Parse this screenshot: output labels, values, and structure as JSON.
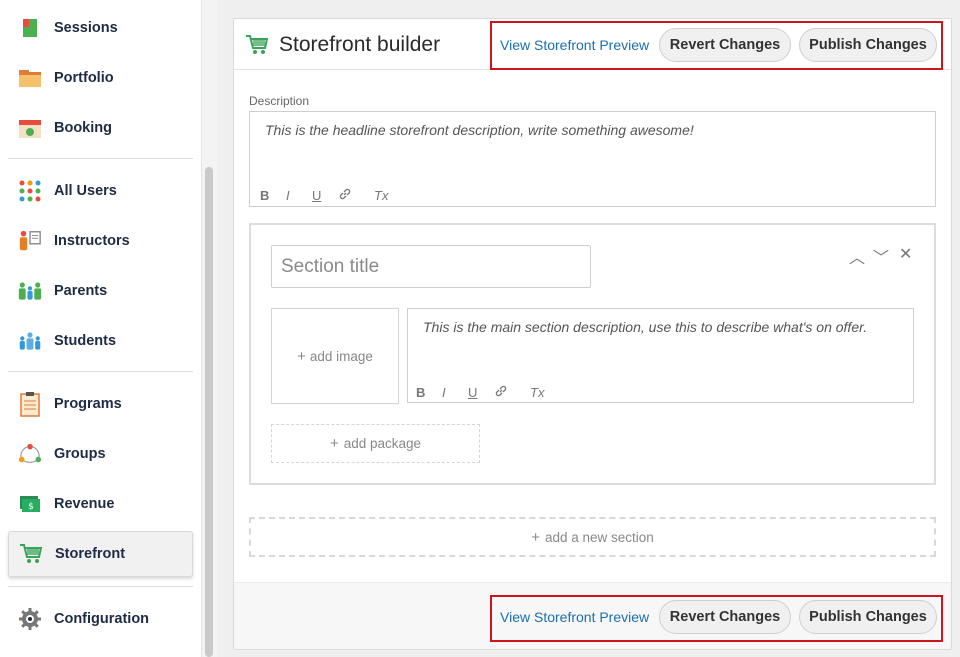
{
  "sidebar": {
    "items": [
      {
        "label": "Sessions",
        "icon": "sessions-icon"
      },
      {
        "label": "Portfolio",
        "icon": "folder-icon"
      },
      {
        "label": "Booking",
        "icon": "calendar-icon"
      },
      {
        "label": "All Users",
        "icon": "all-users-icon"
      },
      {
        "label": "Instructors",
        "icon": "instructor-icon"
      },
      {
        "label": "Parents",
        "icon": "parents-icon"
      },
      {
        "label": "Students",
        "icon": "students-icon"
      },
      {
        "label": "Programs",
        "icon": "clipboard-icon"
      },
      {
        "label": "Groups",
        "icon": "groups-icon"
      },
      {
        "label": "Revenue",
        "icon": "money-icon"
      },
      {
        "label": "Storefront",
        "icon": "cart-icon",
        "active": true
      },
      {
        "label": "Configuration",
        "icon": "gear-icon"
      }
    ]
  },
  "header": {
    "title": "Storefront builder",
    "icon": "cart-icon"
  },
  "actions": {
    "preview_link": "View Storefront Preview",
    "revert_label": "Revert Changes",
    "publish_label": "Publish Changes"
  },
  "description": {
    "label": "Description",
    "placeholder": "This is the headline storefront description, write something awesome!"
  },
  "toolbar": {
    "bold": "B",
    "italic": "I",
    "underline": "U",
    "link": "🔗",
    "clear": "Tx"
  },
  "section": {
    "title_placeholder": "Section title",
    "description_placeholder": "This is the main section description, use this to describe what's on offer.",
    "add_image": "add image",
    "add_package": "add package",
    "controls": {
      "up": "︿",
      "down": "﹀",
      "close": "✕"
    }
  },
  "add_section": "add a new section",
  "plus": "+",
  "colors": {
    "link": "#1a6fb5",
    "highlight_box": "#d0141b",
    "accent_green": "#3aa35a"
  }
}
